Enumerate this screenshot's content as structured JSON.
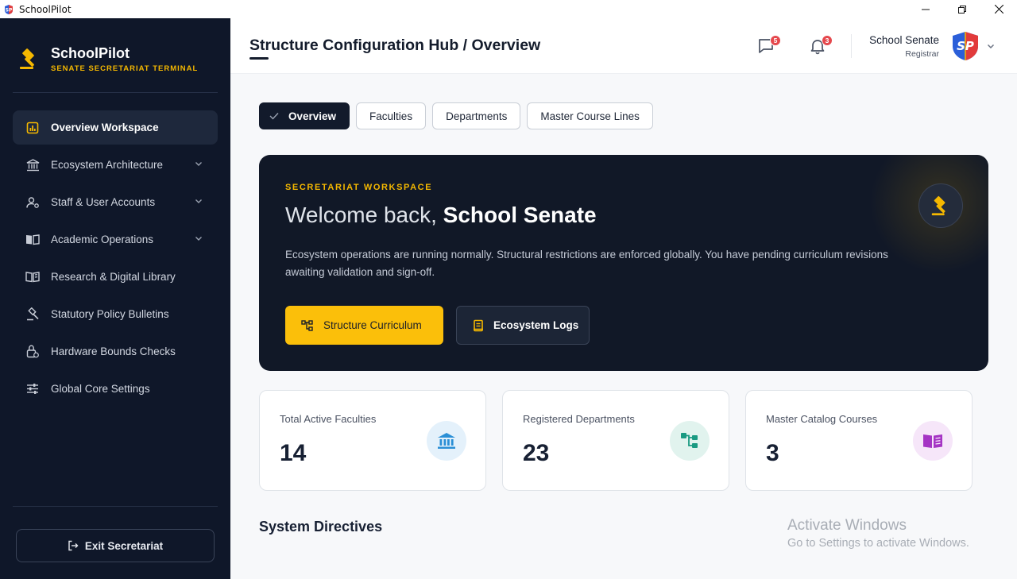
{
  "window": {
    "title": "SchoolPilot"
  },
  "brand": {
    "name": "SchoolPilot",
    "subtitle": "SENATE SECRETARIAT TERMINAL",
    "accent": "#f5b800"
  },
  "sidebar": {
    "items": [
      {
        "label": "Overview Workspace",
        "icon": "chart-bar-icon",
        "active": true,
        "expandable": false
      },
      {
        "label": "Ecosystem Architecture",
        "icon": "institution-icon",
        "active": false,
        "expandable": true
      },
      {
        "label": "Staff & User Accounts",
        "icon": "users-cog-icon",
        "active": false,
        "expandable": true
      },
      {
        "label": "Academic Operations",
        "icon": "book-open-icon",
        "active": false,
        "expandable": true
      },
      {
        "label": "Research & Digital Library",
        "icon": "library-icon",
        "active": false,
        "expandable": false
      },
      {
        "label": "Statutory Policy Bulletins",
        "icon": "gavel-icon",
        "active": false,
        "expandable": false
      },
      {
        "label": "Hardware Bounds Checks",
        "icon": "lock-check-icon",
        "active": false,
        "expandable": false
      },
      {
        "label": "Global Core Settings",
        "icon": "sliders-icon",
        "active": false,
        "expandable": false
      }
    ],
    "exit_label": "Exit Secretariat"
  },
  "header": {
    "title": "Structure Configuration Hub / Overview",
    "messages_count": "5",
    "notifications_count": "3",
    "user_name": "School Senate",
    "user_role": "Registrar",
    "avatar_initials": "SP"
  },
  "tabs": [
    {
      "label": "Overview",
      "active": true
    },
    {
      "label": "Faculties",
      "active": false
    },
    {
      "label": "Departments",
      "active": false
    },
    {
      "label": "Master Course Lines",
      "active": false
    }
  ],
  "hero": {
    "kicker": "SECRETARIAT WORKSPACE",
    "greeting": "Welcome back, ",
    "name": "School Senate",
    "description": "Ecosystem operations are running normally. Structural restrictions are enforced globally. You have pending curriculum revisions awaiting validation and sign-off.",
    "primary_button": "Structure Curriculum",
    "secondary_button": "Ecosystem Logs"
  },
  "stats": [
    {
      "label": "Total Active Faculties",
      "value": "14",
      "icon": "institution-icon",
      "color": "#2a8fd6"
    },
    {
      "label": "Registered Departments",
      "value": "23",
      "icon": "hierarchy-icon",
      "color": "#1a9a82"
    },
    {
      "label": "Master Catalog Courses",
      "value": "3",
      "icon": "book-icon",
      "color": "#a534c4"
    }
  ],
  "section": {
    "title": "System Directives"
  },
  "watermark": {
    "line1": "Activate Windows",
    "line2": "Go to Settings to activate Windows."
  }
}
